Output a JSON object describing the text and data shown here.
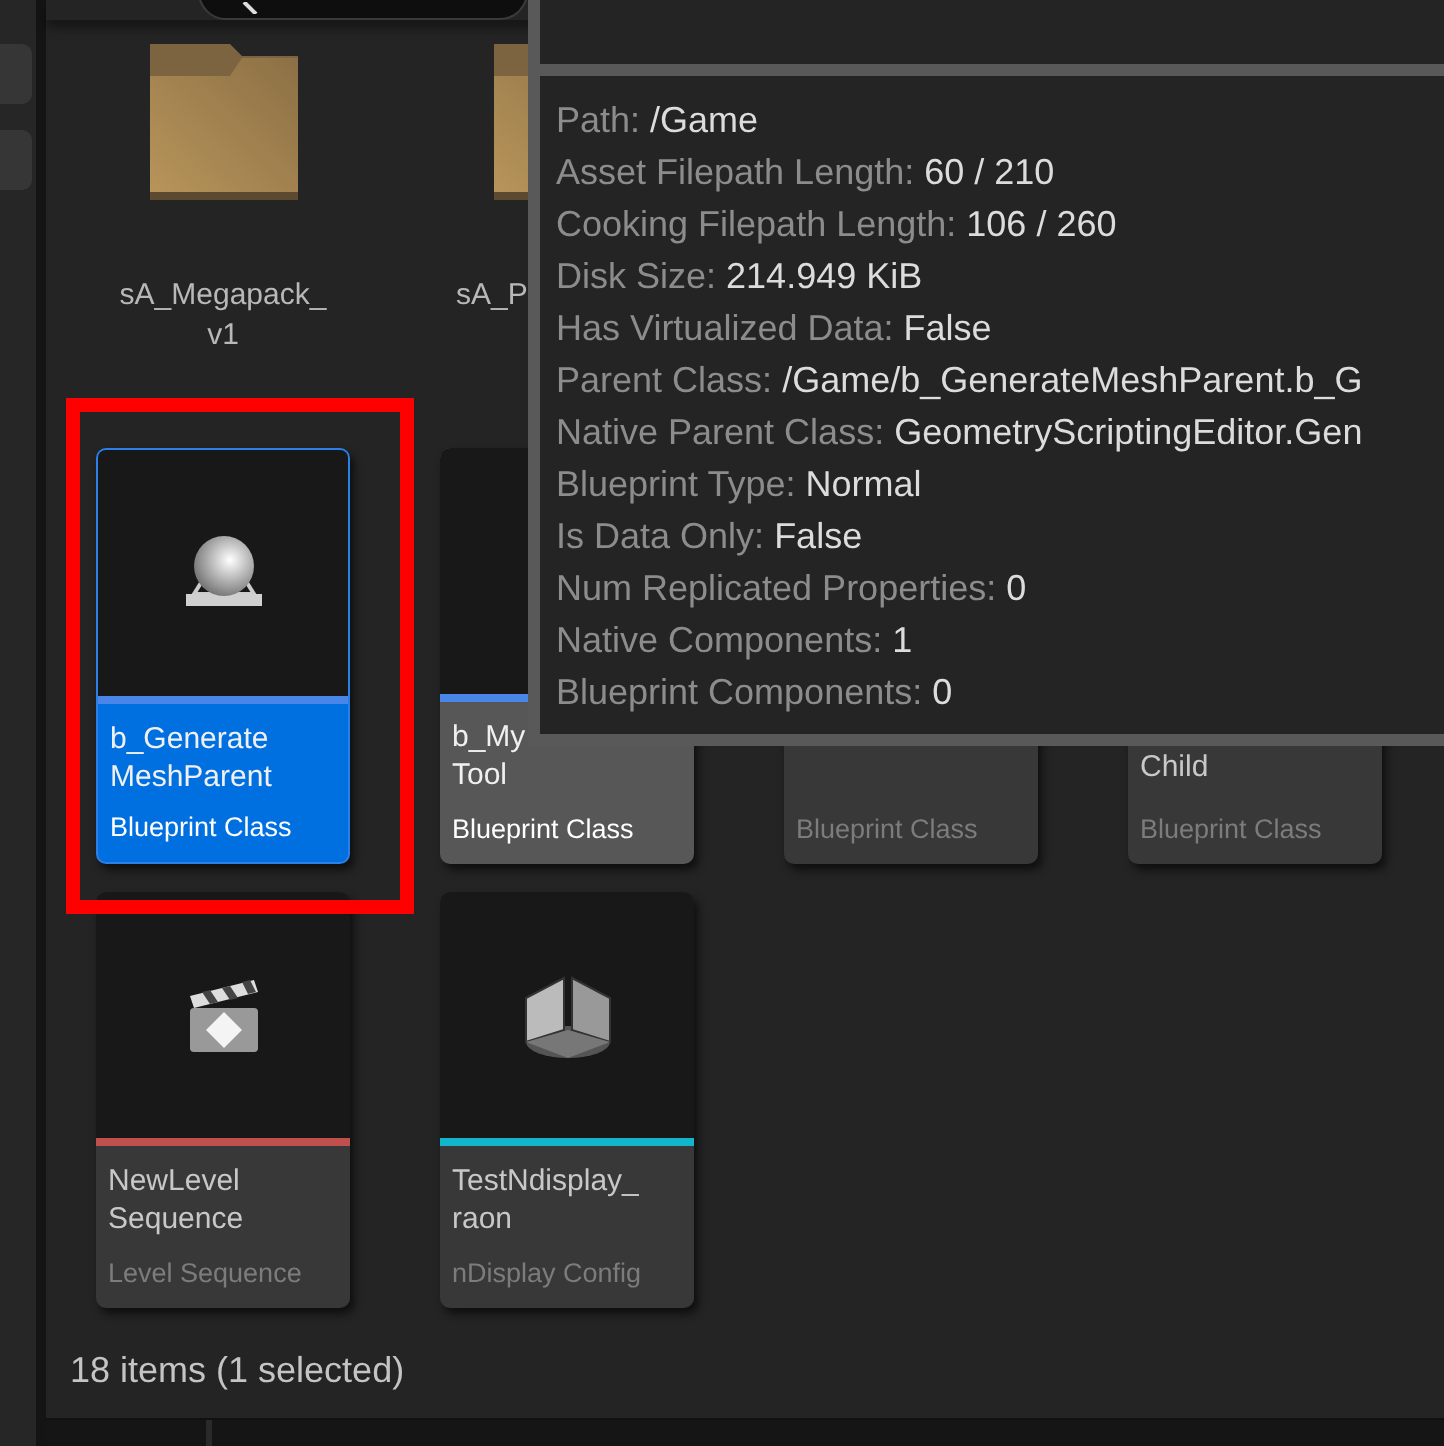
{
  "rows": [
    {
      "tiles": [
        {
          "kind": "folder",
          "name": "sA_Megapack_ v1"
        },
        {
          "kind": "folder",
          "name": "sA_P",
          "covered": true
        }
      ]
    },
    {
      "tiles": [
        {
          "kind": "blueprint",
          "name": "b_Generate MeshParent",
          "type": "Blueprint Class",
          "color": "#4a86e8",
          "selected": true,
          "hovered": false
        },
        {
          "kind": "asset",
          "name": "b_My Tool",
          "type": "Blueprint Class",
          "color": "#4a86e8",
          "selected": false,
          "hovered": true
        },
        {
          "kind": "asset",
          "type": "Blueprint Class",
          "selected": false,
          "hovered": false
        },
        {
          "kind": "asset",
          "name": "Child",
          "type": "Blueprint Class",
          "selected": false,
          "hovered": false
        }
      ]
    },
    {
      "tiles": [
        {
          "kind": "sequence",
          "name": "NewLevel Sequence",
          "type": "Level Sequence",
          "color": "#c0504d",
          "selected": false,
          "hovered": false
        },
        {
          "kind": "ndisplay",
          "name": "TestNdisplay_ raon",
          "type": "nDisplay Config",
          "color": "#12b5cb",
          "selected": false,
          "hovered": false
        }
      ]
    }
  ],
  "tooltip": {
    "rows": [
      {
        "label": "Path:",
        "value": "/Game"
      },
      {
        "label": "Asset Filepath Length:",
        "value": "60 / 210"
      },
      {
        "label": "Cooking Filepath Length:",
        "value": "106 / 260"
      },
      {
        "label": "Disk Size:",
        "value": "214.949 KiB"
      },
      {
        "label": "Has Virtualized Data:",
        "value": "False"
      },
      {
        "label": "Parent Class:",
        "value": "/Game/b_GenerateMeshParent.b_G"
      },
      {
        "label": "Native Parent Class:",
        "value": "GeometryScriptingEditor.Gen"
      },
      {
        "label": "Blueprint Type:",
        "value": "Normal"
      },
      {
        "label": "Is Data Only:",
        "value": "False"
      },
      {
        "label": "Num Replicated Properties:",
        "value": "0"
      },
      {
        "label": "Native Components:",
        "value": "1"
      },
      {
        "label": "Blueprint Components:",
        "value": "0"
      }
    ]
  },
  "status_bar": {
    "text": "18 items (1 selected)"
  }
}
